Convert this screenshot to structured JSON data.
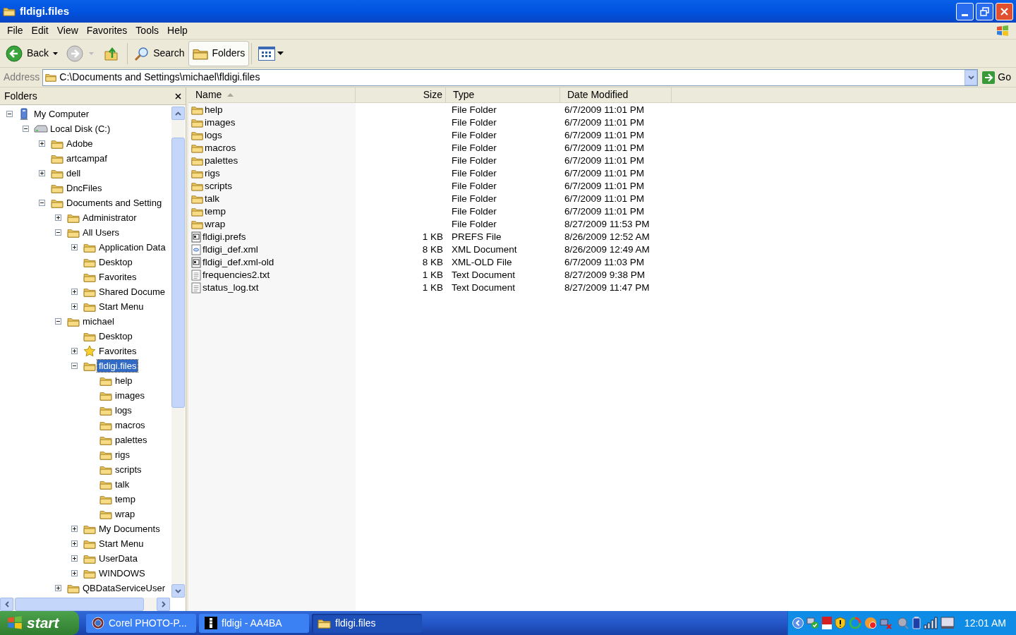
{
  "window": {
    "title": "fldigi.files"
  },
  "menu": [
    "File",
    "Edit",
    "View",
    "Favorites",
    "Tools",
    "Help"
  ],
  "toolbar": [
    {
      "kind": "back",
      "label": "Back",
      "disabled": false
    },
    {
      "kind": "forward",
      "disabled": true
    },
    {
      "kind": "up",
      "disabled": false
    },
    {
      "kind": "search",
      "label": "Search",
      "selected": false
    },
    {
      "kind": "folders",
      "label": "Folders",
      "selected": true
    },
    {
      "kind": "views",
      "disabled": false
    }
  ],
  "address": {
    "label": "Address",
    "value": "C:\\Documents and Settings\\michael\\fldigi.files",
    "go": "Go"
  },
  "folders_pane": {
    "title": "Folders",
    "tree": [
      {
        "label": "My Computer",
        "kind": "computer",
        "selected": false,
        "expanded": true,
        "children": [
          {
            "label": "Local Disk (C:)",
            "kind": "disk",
            "selected": false,
            "expanded": true,
            "children": [
              {
                "label": "Adobe",
                "kind": "folder",
                "selected": false,
                "expanded": false
              },
              {
                "label": "artcampaf",
                "kind": "folder",
                "selected": false
              },
              {
                "label": "dell",
                "kind": "folder",
                "selected": false,
                "expanded": false
              },
              {
                "label": "DncFiles",
                "kind": "folder",
                "selected": false
              },
              {
                "label": "Documents and Setting",
                "kind": "folder",
                "selected": false,
                "expanded": true,
                "children": [
                  {
                    "label": "Administrator",
                    "kind": "folder",
                    "selected": false,
                    "expanded": false
                  },
                  {
                    "label": "All Users",
                    "kind": "folder",
                    "selected": false,
                    "expanded": true,
                    "children": [
                      {
                        "label": "Application Data",
                        "kind": "folder",
                        "selected": false,
                        "expanded": false
                      },
                      {
                        "label": "Desktop",
                        "kind": "folder",
                        "selected": false
                      },
                      {
                        "label": "Favorites",
                        "kind": "folder",
                        "selected": false
                      },
                      {
                        "label": "Shared Docume",
                        "kind": "folder",
                        "selected": false,
                        "expanded": false
                      },
                      {
                        "label": "Start Menu",
                        "kind": "folder",
                        "selected": false,
                        "expanded": false
                      }
                    ]
                  },
                  {
                    "label": "michael",
                    "kind": "folder",
                    "selected": false,
                    "expanded": true,
                    "children": [
                      {
                        "label": "Desktop",
                        "kind": "folder",
                        "selected": false
                      },
                      {
                        "label": "Favorites",
                        "kind": "favorites",
                        "selected": false,
                        "expanded": false
                      },
                      {
                        "label": "fldigi.files",
                        "kind": "folder",
                        "selected": true,
                        "expanded": true,
                        "children": [
                          {
                            "label": "help",
                            "kind": "folder",
                            "selected": false
                          },
                          {
                            "label": "images",
                            "kind": "folder",
                            "selected": false
                          },
                          {
                            "label": "logs",
                            "kind": "folder",
                            "selected": false
                          },
                          {
                            "label": "macros",
                            "kind": "folder",
                            "selected": false
                          },
                          {
                            "label": "palettes",
                            "kind": "folder",
                            "selected": false
                          },
                          {
                            "label": "rigs",
                            "kind": "folder",
                            "selected": false
                          },
                          {
                            "label": "scripts",
                            "kind": "folder",
                            "selected": false
                          },
                          {
                            "label": "talk",
                            "kind": "folder",
                            "selected": false
                          },
                          {
                            "label": "temp",
                            "kind": "folder",
                            "selected": false
                          },
                          {
                            "label": "wrap",
                            "kind": "folder",
                            "selected": false
                          }
                        ]
                      },
                      {
                        "label": "My Documents",
                        "kind": "folder",
                        "selected": false,
                        "expanded": false
                      },
                      {
                        "label": "Start Menu",
                        "kind": "folder",
                        "selected": false,
                        "expanded": false
                      },
                      {
                        "label": "UserData",
                        "kind": "folder",
                        "selected": false,
                        "expanded": false
                      },
                      {
                        "label": "WINDOWS",
                        "kind": "folder",
                        "selected": false,
                        "expanded": false
                      }
                    ]
                  },
                  {
                    "label": "QBDataServiceUser",
                    "kind": "folder",
                    "selected": false,
                    "expanded": false
                  }
                ]
              }
            ]
          }
        ]
      }
    ]
  },
  "list": {
    "columns": [
      {
        "label": "Name",
        "sorted": true
      },
      {
        "label": "Size",
        "sorted": false
      },
      {
        "label": "Type",
        "sorted": false
      },
      {
        "label": "Date Modified",
        "sorted": false
      }
    ],
    "rows": [
      {
        "kind": "folder",
        "name": "help",
        "type": "File Folder",
        "modified": "6/7/2009 11:01 PM"
      },
      {
        "kind": "folder",
        "name": "images",
        "type": "File Folder",
        "modified": "6/7/2009 11:01 PM"
      },
      {
        "kind": "folder",
        "name": "logs",
        "type": "File Folder",
        "modified": "6/7/2009 11:01 PM"
      },
      {
        "kind": "folder",
        "name": "macros",
        "type": "File Folder",
        "modified": "6/7/2009 11:01 PM"
      },
      {
        "kind": "folder",
        "name": "palettes",
        "type": "File Folder",
        "modified": "6/7/2009 11:01 PM"
      },
      {
        "kind": "folder",
        "name": "rigs",
        "type": "File Folder",
        "modified": "6/7/2009 11:01 PM"
      },
      {
        "kind": "folder",
        "name": "scripts",
        "type": "File Folder",
        "modified": "6/7/2009 11:01 PM"
      },
      {
        "kind": "folder",
        "name": "talk",
        "type": "File Folder",
        "modified": "6/7/2009 11:01 PM"
      },
      {
        "kind": "folder",
        "name": "temp",
        "type": "File Folder",
        "modified": "6/7/2009 11:01 PM"
      },
      {
        "kind": "folder",
        "name": "wrap",
        "type": "File Folder",
        "modified": "8/27/2009 11:53 PM"
      },
      {
        "kind": "binary",
        "name": "fldigi.prefs",
        "size": "1 KB",
        "type": "PREFS File",
        "modified": "8/26/2009 12:52 AM"
      },
      {
        "kind": "xml",
        "name": "fldigi_def.xml",
        "size": "8 KB",
        "type": "XML Document",
        "modified": "8/26/2009 12:49 AM"
      },
      {
        "kind": "binary",
        "name": "fldigi_def.xml-old",
        "size": "8 KB",
        "type": "XML-OLD File",
        "modified": "6/7/2009 11:03 PM"
      },
      {
        "kind": "text",
        "name": "frequencies2.txt",
        "size": "1 KB",
        "type": "Text Document",
        "modified": "8/27/2009 9:38 PM"
      },
      {
        "kind": "text",
        "name": "status_log.txt",
        "size": "1 KB",
        "type": "Text Document",
        "modified": "8/27/2009 11:47 PM"
      }
    ]
  },
  "taskbar": {
    "start": "start",
    "tasks": [
      {
        "kind": "camera",
        "label": "Corel PHOTO-P...",
        "selected": false
      },
      {
        "kind": "app",
        "label": "fldigi - AA4BA",
        "selected": false
      },
      {
        "kind": "folder",
        "label": "fldigi.files",
        "selected": true
      }
    ],
    "clock": "12:01 AM"
  }
}
